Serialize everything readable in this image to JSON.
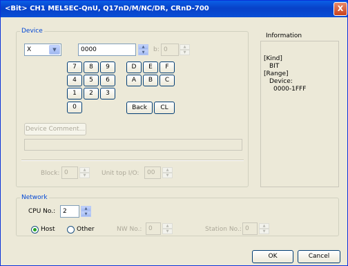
{
  "window": {
    "title": "<Bit> CH1 MELSEC-QnU, Q17nD/M/NC/DR, CRnD-700",
    "close_label": "X"
  },
  "device": {
    "group_label": "Device",
    "type_value": "X",
    "address_value": "0000",
    "b_label": "b:",
    "b_value": "0",
    "keypad": [
      "7",
      "8",
      "9",
      "4",
      "5",
      "6",
      "1",
      "2",
      "3",
      "0",
      "D",
      "E",
      "F",
      "A",
      "B",
      "C"
    ],
    "back_label": "Back",
    "cl_label": "CL",
    "comment_button": "Device Comment...",
    "comment_value": "",
    "block_label": "Block:",
    "block_value": "0",
    "unit_top_label": "Unit top I/O:",
    "unit_top_value": "00"
  },
  "information": {
    "title": "Information",
    "kind_label": "[Kind]",
    "kind_value": "BIT",
    "range_label": "[Range]",
    "range_device_label": "Device:",
    "range_value": "0000-1FFF"
  },
  "network": {
    "group_label": "Network",
    "cpu_label": "CPU No.:",
    "cpu_value": "2",
    "host_label": "Host",
    "other_label": "Other",
    "selected": "Host",
    "nw_label": "NW No.:",
    "nw_value": "0",
    "station_label": "Station No.:",
    "station_value": "0"
  },
  "footer": {
    "ok_label": "OK",
    "cancel_label": "Cancel"
  }
}
